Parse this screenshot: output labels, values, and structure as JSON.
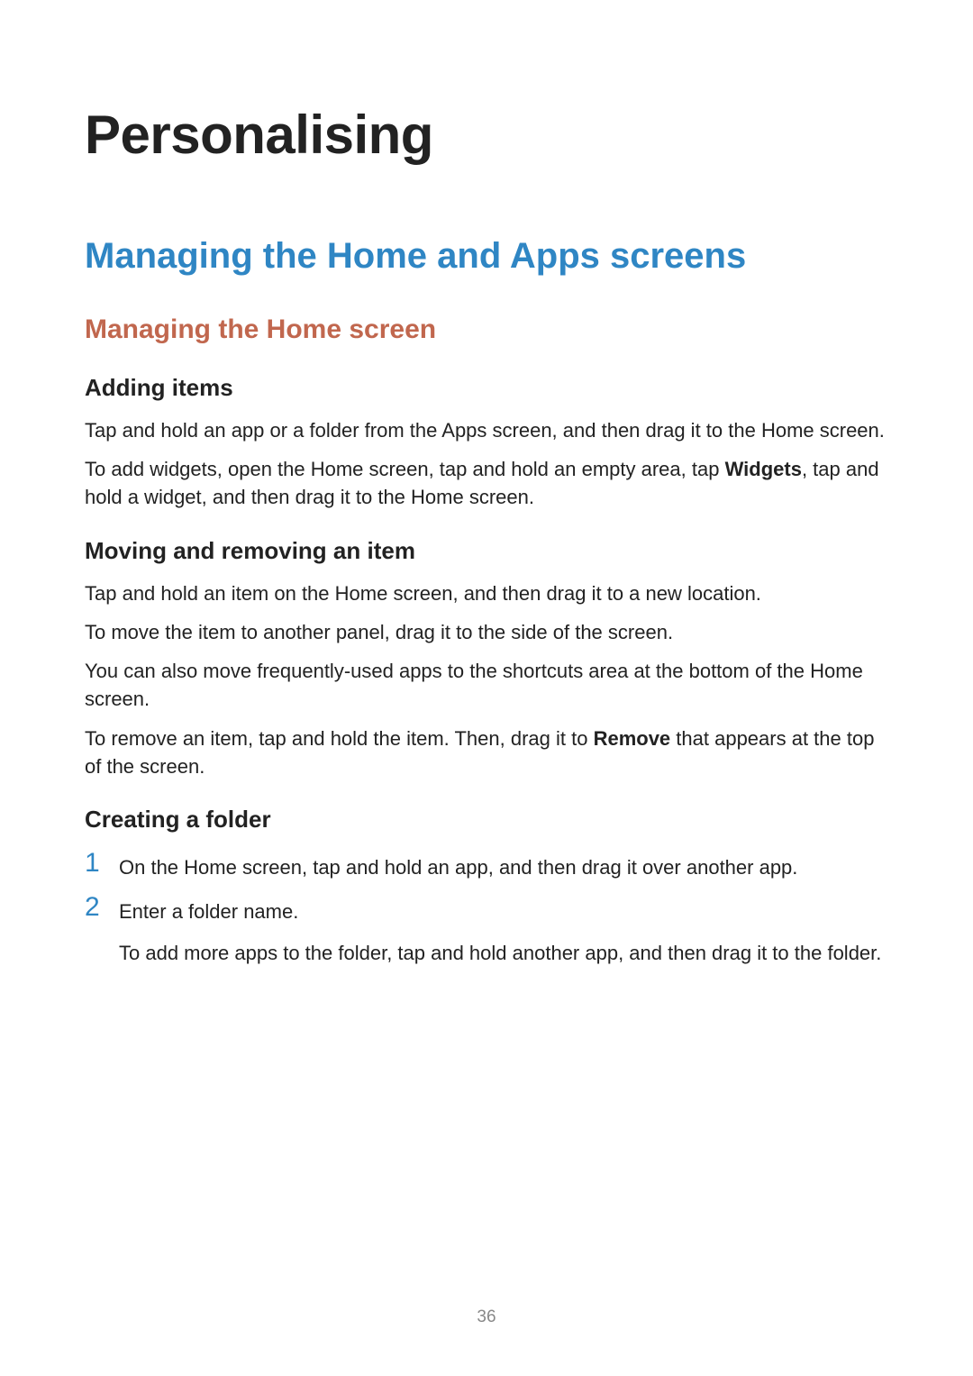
{
  "page_number": "36",
  "title": "Personalising",
  "section_title": "Managing the Home and Apps screens",
  "subsection_title": "Managing the Home screen",
  "blocks": {
    "adding_items": {
      "heading": "Adding items",
      "p1": "Tap and hold an app or a folder from the Apps screen, and then drag it to the Home screen.",
      "p2_a": "To add widgets, open the Home screen, tap and hold an empty area, tap ",
      "p2_bold": "Widgets",
      "p2_b": ", tap and hold a widget, and then drag it to the Home screen."
    },
    "moving_removing": {
      "heading": "Moving and removing an item",
      "p1": "Tap and hold an item on the Home screen, and then drag it to a new location.",
      "p2": "To move the item to another panel, drag it to the side of the screen.",
      "p3": "You can also move frequently-used apps to the shortcuts area at the bottom of the Home screen.",
      "p4_a": "To remove an item, tap and hold the item. Then, drag it to ",
      "p4_bold": "Remove",
      "p4_b": " that appears at the top of the screen."
    },
    "creating_folder": {
      "heading": "Creating a folder",
      "step1_num": "1",
      "step1_text": "On the Home screen, tap and hold an app, and then drag it over another app.",
      "step2_num": "2",
      "step2_text": "Enter a folder name.",
      "step2_sub": "To add more apps to the folder, tap and hold another app, and then drag it to the folder."
    }
  }
}
